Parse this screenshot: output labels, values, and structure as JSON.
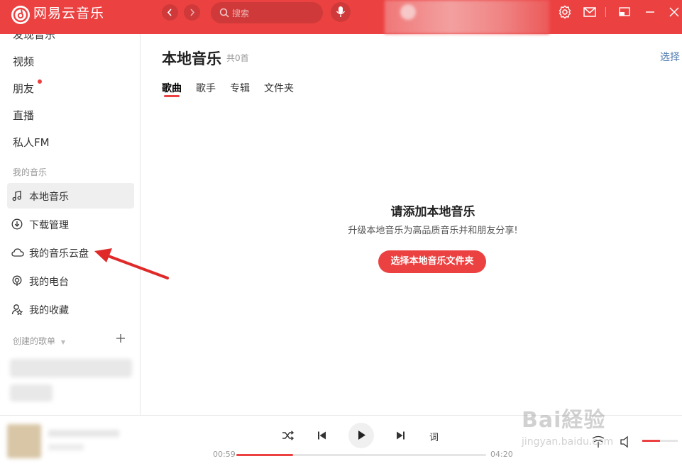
{
  "app": {
    "title": "网易云音乐",
    "brand_color": "#ec4141"
  },
  "header": {
    "search_placeholder": "搜索",
    "icons": [
      "back-icon",
      "forward-icon",
      "search-icon",
      "mic-icon",
      "settings-icon",
      "mail-icon",
      "mini-mode-icon",
      "minimize-icon",
      "close-icon"
    ]
  },
  "sidebar": {
    "nav": [
      {
        "label": "发现音乐"
      },
      {
        "label": "视频"
      },
      {
        "label": "朋友",
        "badge": "dot"
      },
      {
        "label": "直播"
      },
      {
        "label": "私人FM"
      }
    ],
    "my_music_heading": "我的音乐",
    "my_music": [
      {
        "label": "本地音乐",
        "icon": "music-note-icon",
        "active": true
      },
      {
        "label": "下载管理",
        "icon": "download-icon"
      },
      {
        "label": "我的音乐云盘",
        "icon": "cloud-icon"
      },
      {
        "label": "我的电台",
        "icon": "radio-icon"
      },
      {
        "label": "我的收藏",
        "icon": "collection-icon"
      }
    ],
    "playlists_heading": "创建的歌单"
  },
  "main": {
    "title": "本地音乐",
    "count": "共0首",
    "select_link": "选择",
    "tabs": [
      {
        "label": "歌曲",
        "active": true
      },
      {
        "label": "歌手"
      },
      {
        "label": "专辑"
      },
      {
        "label": "文件夹"
      }
    ],
    "empty": {
      "title": "请添加本地音乐",
      "subtitle": "升级本地音乐为高品质音乐并和朋友分享!",
      "button": "选择本地音乐文件夹"
    }
  },
  "player": {
    "current_time": "00:59",
    "total_time": "04:20",
    "progress": 0.227,
    "volume": 0.5,
    "lyric_label": "词"
  },
  "watermark": {
    "logo_text": "Bai経验",
    "url": "jingyan.baidu.com"
  }
}
